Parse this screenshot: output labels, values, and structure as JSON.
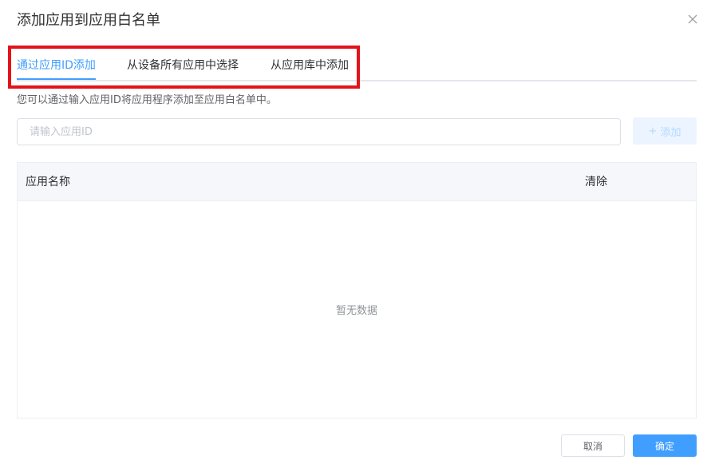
{
  "dialog": {
    "title": "添加应用到应用白名单",
    "close_icon": "close-icon"
  },
  "tabs": [
    {
      "label": "通过应用ID添加",
      "active": true
    },
    {
      "label": "从设备所有应用中选择",
      "active": false
    },
    {
      "label": "从应用库中添加",
      "active": false
    }
  ],
  "hint": "您可以通过输入应用ID将应用程序添加至应用白名单中。",
  "app_id_input": {
    "value": "",
    "placeholder": "请输入应用ID"
  },
  "add_button": {
    "icon": "plus-icon",
    "icon_glyph": "+",
    "label": "添加",
    "disabled": true
  },
  "table": {
    "columns": [
      "应用名称",
      "清除"
    ],
    "rows": [],
    "empty_text": "暂无数据"
  },
  "footer": {
    "cancel_label": "取消",
    "confirm_label": "确定"
  },
  "colors": {
    "accent": "#409eff",
    "highlight": "#e3131b"
  }
}
